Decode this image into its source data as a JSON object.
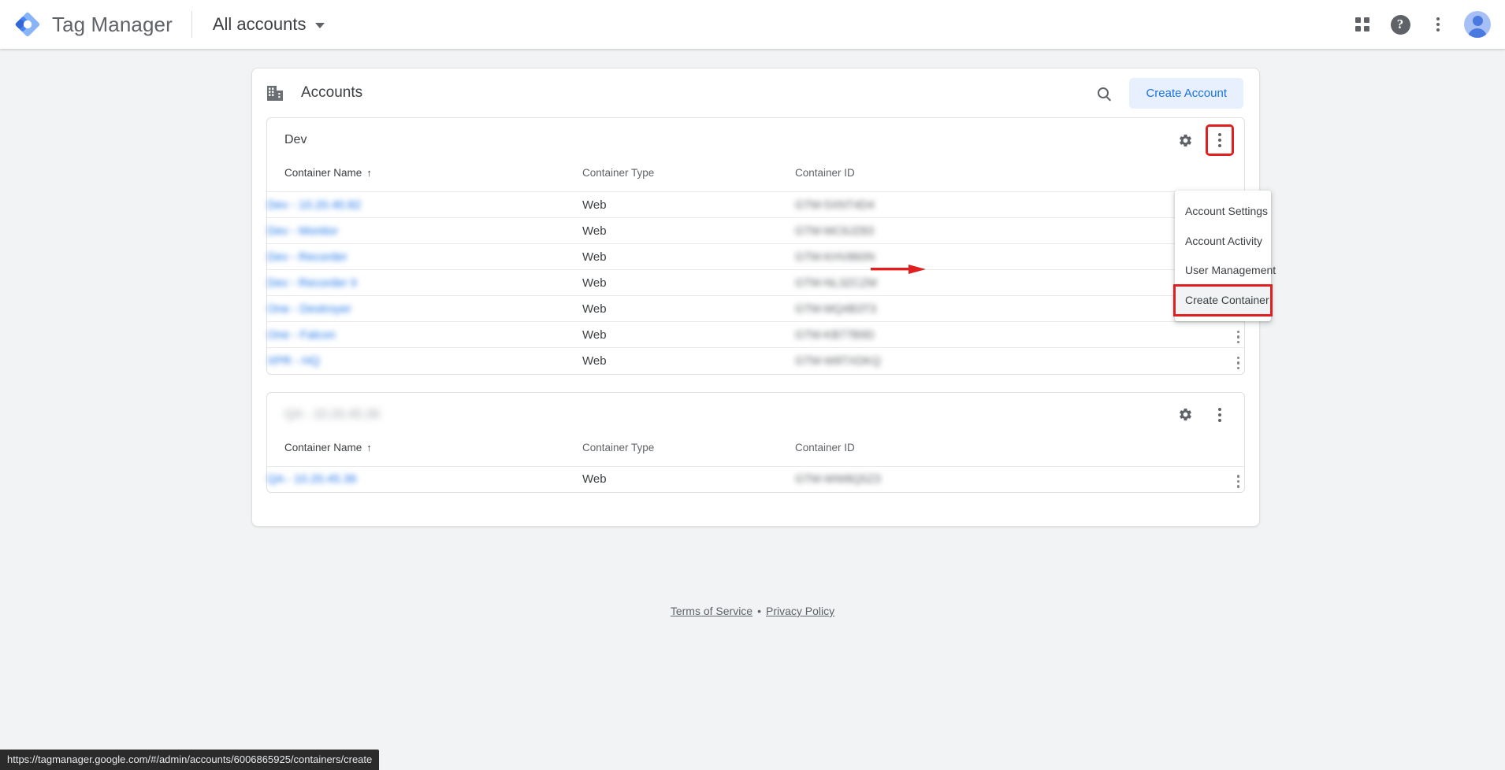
{
  "appbar": {
    "logo_icon": "tag-manager-diamond-logo",
    "brand_title": "Tag Manager",
    "account_switcher_label": "All accounts",
    "caret_icon": "chevron-down-icon",
    "apps_icon": "apps-grid-icon",
    "help_icon": "help-question-icon",
    "overflow_icon": "more-vert-icon",
    "avatar_icon": "user-avatar"
  },
  "card": {
    "icon": "building-icon",
    "title": "Accounts",
    "search_icon": "search-icon",
    "create_account_label": "Create Account"
  },
  "table_headers": {
    "container_name": "Container Name",
    "sort_arrow": "↑",
    "container_type": "Container Type",
    "container_id": "Container ID"
  },
  "accounts": [
    {
      "name": "Dev",
      "redacted": false,
      "gear_icon": "settings-gear-icon",
      "kebab_icon": "more-vert-icon",
      "kebab_highlighted": true,
      "containers": [
        {
          "name": "Dev - 10.20.40.82",
          "type": "Web",
          "id": "GTM-5XNT4D4"
        },
        {
          "name": "Dev - Monitor",
          "type": "Web",
          "id": "GTM-MC6JZ83"
        },
        {
          "name": "Dev - Recorder",
          "type": "Web",
          "id": "GTM-KHV860N"
        },
        {
          "name": "Dev - Recorder II",
          "type": "Web",
          "id": "GTM-NL3ZCZM"
        },
        {
          "name": "One - Destroyer",
          "type": "Web",
          "id": "GTM-MQ4B3T3"
        },
        {
          "name": "One - Falcon",
          "type": "Web",
          "id": "GTM-KB77B9D"
        },
        {
          "name": "XPR - HQ",
          "type": "Web",
          "id": "GTM-W8TXDKQ"
        }
      ]
    },
    {
      "name": "QA - 10.20.45.36",
      "redacted": true,
      "gear_icon": "settings-gear-icon",
      "kebab_icon": "more-vert-icon",
      "kebab_highlighted": false,
      "containers": [
        {
          "name": "QA - 10.20.45.36",
          "type": "Web",
          "id": "GTM-WW8Q5Z3"
        }
      ]
    }
  ],
  "account_menu": {
    "items": [
      {
        "label": "Account Settings",
        "active": false,
        "boxed": false
      },
      {
        "label": "Account Activity",
        "active": false,
        "boxed": false
      },
      {
        "label": "User Management",
        "active": false,
        "boxed": false
      },
      {
        "label": "Create Container",
        "active": true,
        "boxed": true
      }
    ]
  },
  "annotation": {
    "arrow_icon": "red-arrow-right",
    "color": "#e02020"
  },
  "footer": {
    "terms_label": "Terms of Service",
    "separator": "•",
    "privacy_label": "Privacy Policy"
  },
  "statusbar": {
    "url": "https://tagmanager.google.com/#/admin/accounts/6006865925/containers/create"
  },
  "colors": {
    "accent_blue": "#1a73e8",
    "button_bg": "#e8f0fe",
    "page_bg": "#f1f3f4",
    "annotation_red": "#e02020",
    "text_primary": "#3c4043",
    "text_secondary": "#5f6368"
  }
}
